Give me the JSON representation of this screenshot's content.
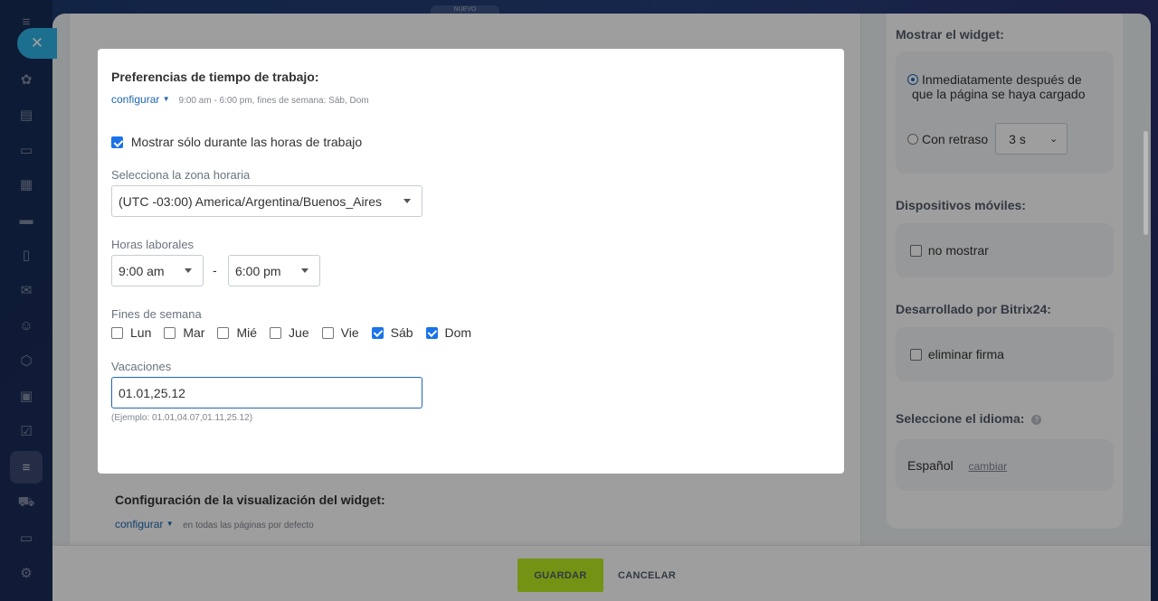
{
  "nuevo_tab": "NUEVO",
  "sidebar_icons": [
    "menu-icon",
    "puzzle-icon",
    "document-icon",
    "chat-icon",
    "calendar-icon",
    "drive-icon",
    "file-icon",
    "mail-icon",
    "contacts-icon",
    "hexagon-icon",
    "presentation-icon",
    "checklist-icon",
    "funnel-icon",
    "cart-icon",
    "card-icon",
    "settings-icon"
  ],
  "modal": {
    "title": "Preferencias de tiempo de trabajo:",
    "configure_label": "configurar",
    "summary": "9:00 am - 6:00 pm, fines de semana: Sáb, Dom",
    "show_only_working_hours": "Mostrar sólo durante las horas de trabajo",
    "show_only_checked": true,
    "timezone_label": "Selecciona la zona horaria",
    "timezone_value": "(UTC -03:00) America/Argentina/Buenos_Aires",
    "hours_label": "Horas laborales",
    "hours_from": "9:00 am",
    "hours_separator": "-",
    "hours_to": "6:00 pm",
    "weekends_label": "Fines de semana",
    "days": [
      {
        "label": "Lun",
        "checked": false
      },
      {
        "label": "Mar",
        "checked": false
      },
      {
        "label": "Mié",
        "checked": false
      },
      {
        "label": "Jue",
        "checked": false
      },
      {
        "label": "Vie",
        "checked": false
      },
      {
        "label": "Sáb",
        "checked": true
      },
      {
        "label": "Dom",
        "checked": true
      }
    ],
    "vacations_label": "Vacaciones",
    "vacations_value": "01.01,25.12",
    "vacations_hint": "(Ejemplo: 01.01,04.07,01.11,25.12)"
  },
  "lower": {
    "title": "Configuración de la visualización del widget:",
    "configure_label": "configurar",
    "note": "en todas las páginas por defecto"
  },
  "right": {
    "show_widget_title": "Mostrar el widget:",
    "immediately_label": "Inmediatamente después de que la página se haya cargado",
    "delay_label": "Con retraso",
    "delay_value": "3 s",
    "mobile_title": "Dispositivos móviles:",
    "no_show_label": "no mostrar",
    "developed_title": "Desarrollado por Bitrix24:",
    "remove_signature_label": "eliminar firma",
    "language_title": "Seleccione el idioma:",
    "language_value": "Español",
    "change_label": "cambiar"
  },
  "footer": {
    "save_label": "GUARDAR",
    "cancel_label": "CANCELAR"
  },
  "colors": {
    "save_button": "#bbed21",
    "close_button": "#2fb4e9",
    "link": "#2067b0",
    "checkbox": "#1a73e8"
  }
}
